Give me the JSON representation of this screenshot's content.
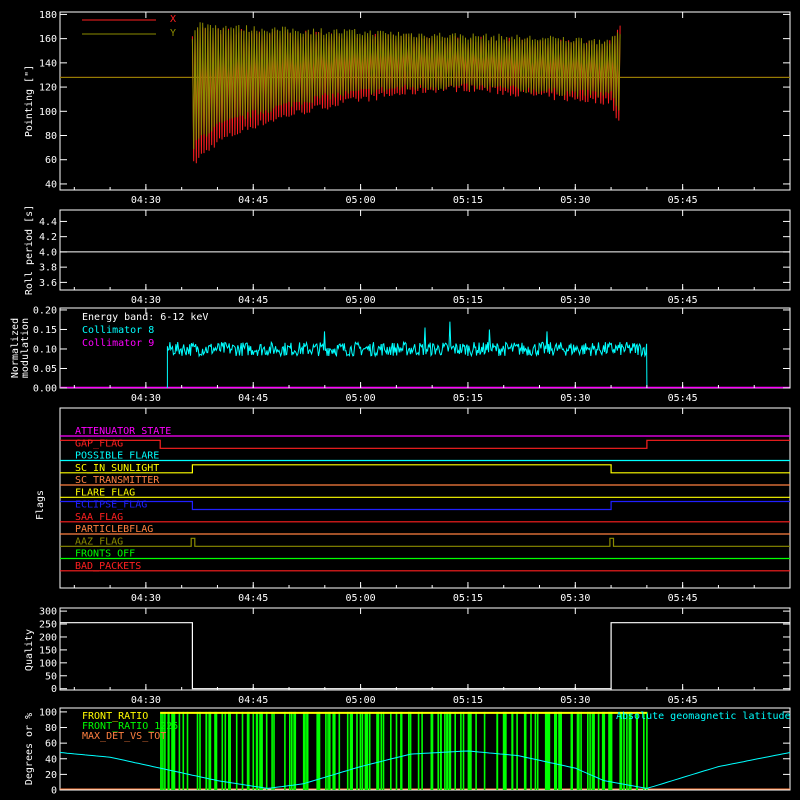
{
  "colors": {
    "bg": "#000000",
    "axis": "#ffffff",
    "red": "#ff2020",
    "olive": "#8c8c00",
    "white": "#ffffff",
    "cyan": "#00ffff",
    "magenta": "#ff00ff",
    "green": "#00ff00",
    "yellow": "#ffff00",
    "orange": "#ff8040",
    "blue": "#2020ff"
  },
  "time_axis": {
    "range": [
      "04:18",
      "06:00"
    ],
    "ticks": [
      "04:30",
      "04:45",
      "05:00",
      "05:15",
      "05:30",
      "05:45"
    ]
  },
  "chart_data": [
    {
      "id": "pointing",
      "type": "line",
      "ylabel": "Pointing [\"]",
      "ylim": [
        35,
        182
      ],
      "yticks": [
        40,
        60,
        80,
        100,
        120,
        140,
        160,
        180
      ],
      "legend": {
        "placement": "top-left",
        "entries": [
          "X",
          "Y"
        ]
      },
      "series": [
        {
          "name": "X",
          "color_key": "red",
          "baseline": 128,
          "t": [
            "04:36:30",
            "04:37:30",
            "04:40",
            "04:45",
            "04:50",
            "04:55",
            "05:00",
            "05:05",
            "05:10",
            "05:15",
            "05:20",
            "05:25",
            "05:30",
            "05:35",
            "05:36:20"
          ],
          "upper": [
            165,
            168,
            166,
            165,
            164,
            163,
            162,
            161,
            160,
            159,
            158,
            157,
            156,
            156,
            170
          ],
          "lower": [
            55,
            62,
            75,
            88,
            97,
            104,
            110,
            114,
            118,
            119,
            116,
            113,
            110,
            108,
            88
          ]
        },
        {
          "name": "Y",
          "color_key": "olive",
          "baseline": 128,
          "t": [
            "04:36:30",
            "04:37:30",
            "04:40",
            "04:45",
            "04:50",
            "04:55",
            "05:00",
            "05:05",
            "05:10",
            "05:15",
            "05:20",
            "05:25",
            "05:30",
            "05:35",
            "05:36:20"
          ],
          "upper": [
            162,
            172,
            170,
            168,
            167,
            166,
            165,
            164,
            163,
            162,
            161,
            160,
            159,
            158,
            165
          ],
          "lower": [
            68,
            78,
            88,
            98,
            106,
            112,
            116,
            119,
            120,
            120,
            119,
            117,
            115,
            114,
            100
          ]
        }
      ]
    },
    {
      "id": "roll",
      "type": "line",
      "ylabel": "Roll period [s]",
      "ylim": [
        3.5,
        4.55
      ],
      "yticks": [
        "3.6",
        "3.8",
        "4.0",
        "4.2",
        "4.4"
      ],
      "series": [
        {
          "color_key": "white",
          "t": [
            "04:18",
            "06:00"
          ],
          "values": [
            4.0,
            4.0
          ]
        }
      ]
    },
    {
      "id": "modulation",
      "type": "line",
      "ylabel": [
        "Normalized",
        "modulation"
      ],
      "ylim": [
        0,
        0.205
      ],
      "yticks": [
        "0.00",
        "0.05",
        "0.10",
        "0.15",
        "0.20"
      ],
      "annotation": "Energy band: 6-12 keV",
      "legend": {
        "placement": "top-left",
        "entries": [
          "Collimator 8",
          "Collimator 9"
        ]
      },
      "series": [
        {
          "name": "Collimator 8",
          "color_key": "cyan",
          "t_start": "04:33",
          "t_end": "05:40",
          "mean": 0.1,
          "spread": 0.018,
          "spikes": [
            [
              "05:12:30",
              0.17
            ],
            [
              "05:09",
              0.155
            ],
            [
              "05:18",
              0.15
            ],
            [
              "04:55",
              0.145
            ],
            [
              "05:26",
              0.145
            ]
          ]
        },
        {
          "name": "Collimator 9",
          "color_key": "magenta",
          "t": [
            "04:18",
            "06:00"
          ],
          "values": [
            0,
            0
          ]
        }
      ]
    },
    {
      "id": "flags",
      "type": "line",
      "ylabel": "Flags",
      "series": [
        {
          "name": "ATTENUATOR_STATE",
          "color_key": "magenta",
          "segments": [
            [
              "04:18",
              0
            ],
            [
              "06:00",
              0
            ]
          ]
        },
        {
          "name": "GAP_FLAG",
          "color_key": "red",
          "segments": [
            [
              "04:18",
              1
            ],
            [
              "04:32",
              1
            ],
            [
              "04:32",
              0
            ],
            [
              "05:40",
              0
            ],
            [
              "05:40",
              1
            ],
            [
              "06:00",
              1
            ]
          ]
        },
        {
          "name": "POSSIBLE_FLARE",
          "color_key": "cyan",
          "segments": [
            [
              "04:18",
              0
            ],
            [
              "06:00",
              0
            ]
          ]
        },
        {
          "name": "SC_IN_SUNLIGHT",
          "color_key": "yellow",
          "segments": [
            [
              "04:18",
              0
            ],
            [
              "04:36:30",
              0
            ],
            [
              "04:36:30",
              1
            ],
            [
              "05:35",
              1
            ],
            [
              "05:35",
              0
            ],
            [
              "06:00",
              0
            ]
          ]
        },
        {
          "name": "SC_TRANSMITTER",
          "color_key": "orange",
          "segments": [
            [
              "04:18",
              0
            ],
            [
              "06:00",
              0
            ]
          ]
        },
        {
          "name": "FLARE_FLAG",
          "color_key": "yellow",
          "segments": [
            [
              "04:18",
              0
            ],
            [
              "06:00",
              0
            ]
          ]
        },
        {
          "name": "ECLIPSE_FLAG",
          "color_key": "blue",
          "segments": [
            [
              "04:18",
              1
            ],
            [
              "04:36:30",
              1
            ],
            [
              "04:36:30",
              0
            ],
            [
              "05:35",
              0
            ],
            [
              "05:35",
              1
            ],
            [
              "06:00",
              1
            ]
          ]
        },
        {
          "name": "SAA_FLAG",
          "color_key": "red",
          "segments": [
            [
              "04:18",
              0
            ],
            [
              "06:00",
              0
            ]
          ]
        },
        {
          "name": "PARTICLEBFLAG",
          "color_key": "orange",
          "segments": [
            [
              "04:18",
              0
            ],
            [
              "06:00",
              0
            ]
          ]
        },
        {
          "name": "AAZ_FLAG",
          "color_key": "olive",
          "segments": [
            [
              "04:18",
              0
            ],
            [
              "04:36:20",
              0
            ],
            [
              "04:36:20",
              1
            ],
            [
              "04:36:50",
              1
            ],
            [
              "04:36:50",
              0
            ],
            [
              "05:34:50",
              0
            ],
            [
              "05:34:50",
              1
            ],
            [
              "05:35:20",
              1
            ],
            [
              "05:35:20",
              0
            ],
            [
              "06:00",
              0
            ]
          ]
        },
        {
          "name": "FRONTS_OFF",
          "color_key": "green",
          "segments": [
            [
              "04:18",
              0
            ],
            [
              "06:00",
              0
            ]
          ]
        },
        {
          "name": "BAD_PACKETS",
          "color_key": "red",
          "segments": [
            [
              "04:18",
              0
            ],
            [
              "06:00",
              0
            ]
          ]
        }
      ]
    },
    {
      "id": "quality",
      "type": "line",
      "ylabel": "Quality",
      "ylim": [
        -5,
        312
      ],
      "yticks": [
        0,
        50,
        100,
        150,
        200,
        250,
        300
      ],
      "series": [
        {
          "color_key": "white",
          "t": [
            "04:18",
            "04:36:30",
            "04:36:30",
            "05:35",
            "05:35",
            "06:00"
          ],
          "values": [
            255,
            255,
            0,
            0,
            255,
            255
          ]
        }
      ]
    },
    {
      "id": "degrees",
      "type": "line",
      "ylabel": "Degrees or %",
      "ylim": [
        0,
        105
      ],
      "yticks": [
        0,
        20,
        40,
        60,
        80,
        100
      ],
      "legend": {
        "placement": "top-left",
        "entries": [
          "FRONT_RATIO",
          "FRONT_RATIO_1225",
          "MAX_DET_VS_TOT"
        ]
      },
      "right_legend": "Absolute geomagnetic latitude",
      "series": [
        {
          "name": "FRONT_RATIO",
          "color_key": "yellow",
          "t_start": "04:32",
          "t_end": "05:40",
          "value": 100
        },
        {
          "name": "FRONT_RATIO_1225",
          "color_key": "green",
          "t_start": "04:32",
          "t_end": "05:40",
          "bars": 160
        },
        {
          "name": "MAX_DET_VS_TOT",
          "color_key": "orange",
          "t": [
            "04:18",
            "06:00"
          ],
          "values": [
            0,
            0
          ]
        },
        {
          "name": "Absolute geomagnetic latitude",
          "color_key": "cyan",
          "t": [
            "04:18",
            "04:25",
            "04:32",
            "04:40",
            "04:47",
            "04:52",
            "05:00",
            "05:07",
            "05:15",
            "05:22",
            "05:30",
            "05:34",
            "05:40",
            "05:50",
            "06:00"
          ],
          "values": [
            48,
            42,
            28,
            12,
            2,
            8,
            30,
            46,
            50,
            44,
            28,
            12,
            2,
            30,
            48
          ]
        }
      ]
    }
  ]
}
